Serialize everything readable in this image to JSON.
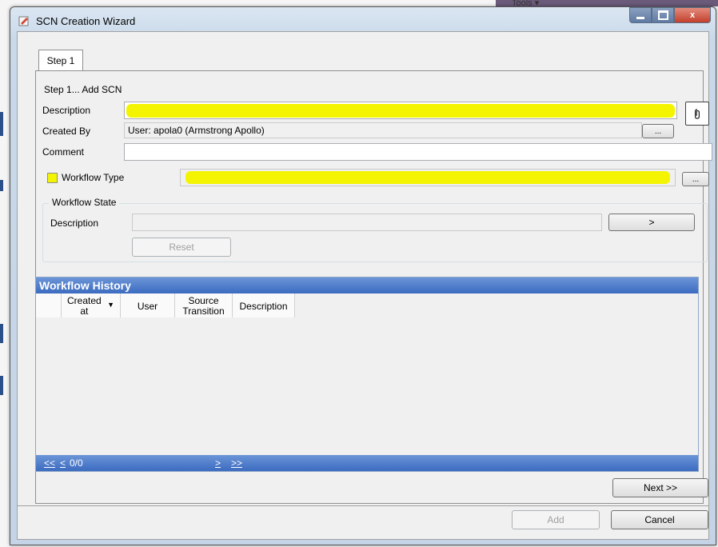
{
  "window": {
    "title": "SCN Creation Wizard",
    "caption_close": "x"
  },
  "background": {
    "tools_menu": "Tools ▾"
  },
  "tabs": [
    {
      "label": "Step 1"
    }
  ],
  "step": {
    "heading": "Step 1... Add SCN"
  },
  "form": {
    "description_label": "Description",
    "description_value": "",
    "attach_icon": "paperclip-icon",
    "created_by_label": "Created By",
    "created_by_value": "User: apola0 (Armstrong Apollo)",
    "browse_label": "...",
    "comment_label": "Comment",
    "comment_value": "",
    "workflow_type_label": "Workflow Type",
    "workflow_type_checked": false,
    "workflow_type_value": "",
    "workflow_browse_label": "..."
  },
  "workflow_state": {
    "legend": "Workflow State",
    "description_label": "Description",
    "description_value": "",
    "advance_label": ">",
    "reset_label": "Reset"
  },
  "history": {
    "title": "Workflow History",
    "columns": [
      {
        "label": "Created\nat",
        "sort": "desc"
      },
      {
        "label": "User"
      },
      {
        "label": "Source\nTransition"
      },
      {
        "label": "Description"
      }
    ],
    "pager": {
      "first": "<<",
      "prev": "<",
      "count": "0/0",
      "next": ">",
      "last": ">>"
    }
  },
  "footer": {
    "next_label": "Next >>",
    "add_label": "Add",
    "cancel_label": "Cancel"
  },
  "colors": {
    "highlight": "#f4f400",
    "grid_header": "#3c6bc0"
  }
}
